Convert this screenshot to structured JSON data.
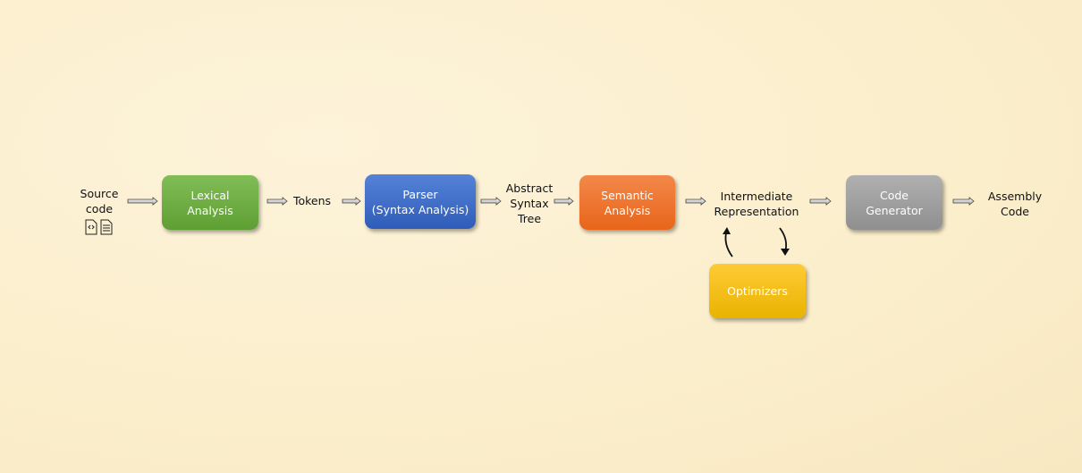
{
  "nodes": {
    "source": "Source\ncode",
    "lexical": "Lexical\nAnalysis",
    "tokens": "Tokens",
    "parser": "Parser\n(Syntax Analysis)",
    "ast": "Abstract\nSyntax\nTree",
    "semantic": "Semantic\nAnalysis",
    "ir": "Intermediate\nRepresentation",
    "codegen": "Code\nGenerator",
    "assembly": "Assembly\nCode",
    "optimizers": "Optimizers"
  },
  "colors": {
    "lexical": "#6aab3e",
    "parser": "#3f6cc8",
    "semantic": "#ee7326",
    "codegen": "#a3a3a3",
    "optimizers": "#f5bf0a"
  },
  "icons": [
    "code-file-icon",
    "text-file-icon"
  ]
}
